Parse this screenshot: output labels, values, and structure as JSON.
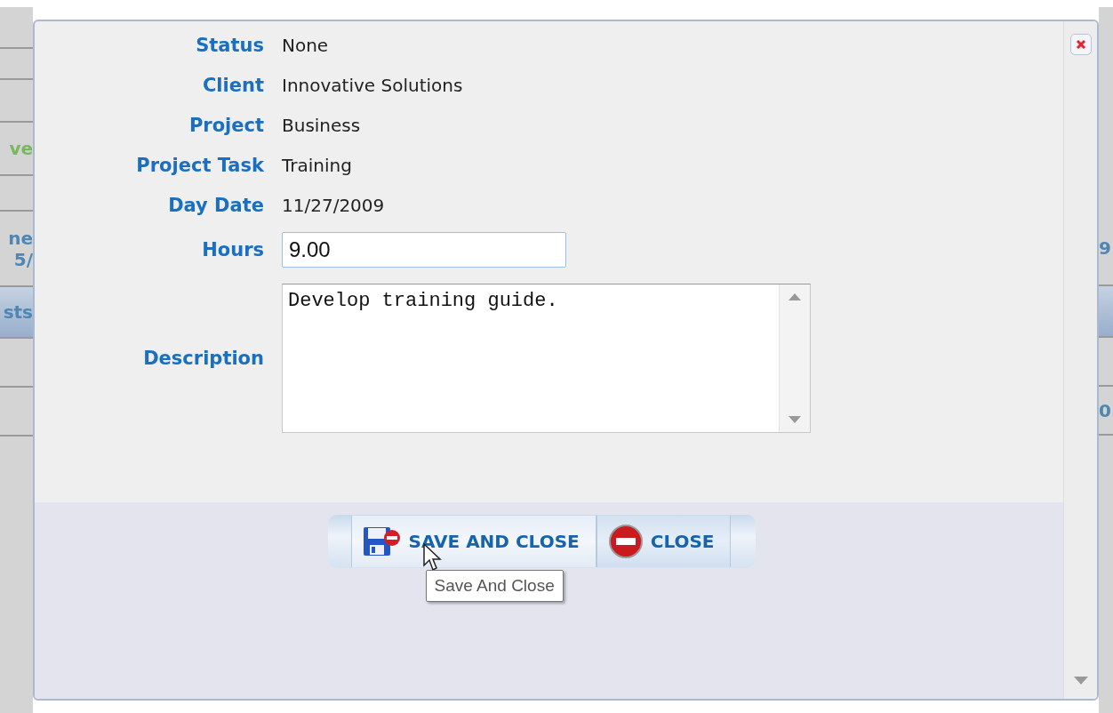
{
  "background": {
    "left_fragments": [
      "ve",
      "ne",
      "5/",
      "sts"
    ],
    "right_fragments": [
      "9",
      "0"
    ]
  },
  "dialog": {
    "fields": [
      {
        "label": "Status",
        "kind": "text",
        "value": "None"
      },
      {
        "label": "Client",
        "kind": "text",
        "value": "Innovative Solutions"
      },
      {
        "label": "Project",
        "kind": "text",
        "value": "Business"
      },
      {
        "label": "Project Task",
        "kind": "text",
        "value": "Training"
      },
      {
        "label": "Day Date",
        "kind": "text",
        "value": "11/27/2009"
      },
      {
        "label": "Hours",
        "kind": "input",
        "value": "9.00"
      },
      {
        "label": "Description",
        "kind": "textarea",
        "value": "Develop training guide."
      }
    ],
    "buttons": [
      {
        "label": "SAVE AND CLOSE",
        "kind": "save"
      },
      {
        "label": "CLOSE",
        "kind": "close"
      }
    ],
    "tooltip": "Save And Close"
  }
}
